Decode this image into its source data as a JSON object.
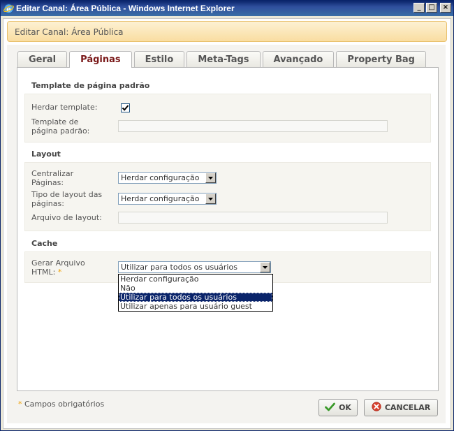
{
  "window": {
    "title": "Editar Canal: Área Pública - Windows Internet Explorer",
    "controls": {
      "minimize": "_",
      "maximize": "□",
      "close": "×"
    }
  },
  "dialog": {
    "title": "Editar Canal: Área Pública"
  },
  "tabs": [
    {
      "label": "Geral",
      "active": false
    },
    {
      "label": "Páginas",
      "active": true
    },
    {
      "label": "Estilo",
      "active": false
    },
    {
      "label": "Meta-Tags",
      "active": false
    },
    {
      "label": "Avançado",
      "active": false
    },
    {
      "label": "Property Bag",
      "active": false
    }
  ],
  "sections": {
    "template": {
      "title": "Template de página padrão",
      "inherit_label": "Herdar template:",
      "inherit_checked": true,
      "template_label_line1": "Template de",
      "template_label_line2": "página padrão:",
      "template_value": ""
    },
    "layout": {
      "title": "Layout",
      "center_label_line1": "Centralizar",
      "center_label_line2": "Páginas:",
      "center_value": "Herdar configuração",
      "type_label_line1": "Tipo de layout das",
      "type_label_line2": "páginas:",
      "type_value": "Herdar configuração",
      "file_label": "Arquivo de layout:",
      "file_value": ""
    },
    "cache": {
      "title": "Cache",
      "gen_label_line1": "Gerar Arquivo",
      "gen_label_line2": "HTML:",
      "required_mark": "*",
      "gen_value": "Utilizar para todos os usuários",
      "options": [
        "Herdar configuração",
        "Não",
        "Utilizar para todos os usuários",
        "Utilizar apenas para usuário guest"
      ],
      "selected_index": 2
    }
  },
  "footer": {
    "required_mark": "*",
    "required_note": "Campos obrigatórios",
    "ok_label": "OK",
    "cancel_label": "CANCELAR"
  },
  "colors": {
    "active_tab": "#7a1919",
    "title_bar": "#0a246a",
    "header_bg": "#f9dda1",
    "selection": "#0a246a",
    "required": "#f0a000",
    "ok_icon": "#3a9a2a",
    "cancel_icon": "#d9402e"
  },
  "icons": {
    "title": "internet-explorer-icon",
    "ok": "check-icon",
    "cancel": "cancel-icon",
    "dropdown": "chevron-down-icon"
  }
}
